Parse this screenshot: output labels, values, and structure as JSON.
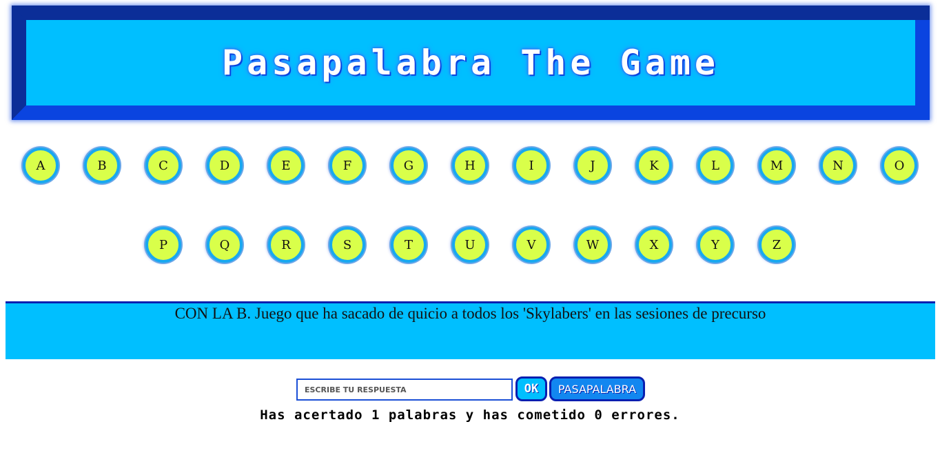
{
  "header": {
    "title": "Pasapalabra The Game"
  },
  "letters": {
    "row1": [
      "A",
      "B",
      "C",
      "D",
      "E",
      "F",
      "G",
      "H",
      "I",
      "J",
      "K",
      "L",
      "M",
      "N",
      "O"
    ],
    "row2": [
      "P",
      "Q",
      "R",
      "S",
      "T",
      "U",
      "V",
      "W",
      "X",
      "Y",
      "Z"
    ]
  },
  "question": {
    "text": "CON LA B. Juego que ha sacado de quicio a todos los 'Skylabers' en las sesiones de precurso"
  },
  "controls": {
    "answer_placeholder": "ESCRIBE TU RESPUESTA",
    "answer_value": "",
    "ok_label": "OK",
    "pasapalabra_label": "PASAPALABRA"
  },
  "status": {
    "score_text": "Has acertado 1 palabras y has cometido 0 errores."
  },
  "colors": {
    "banner_frame": "#0a44e0",
    "banner_fill": "#00bfff",
    "letter_fill": "#d9ff4a",
    "letter_ring": "#18a8f0",
    "panel_fill": "#00bfff"
  }
}
